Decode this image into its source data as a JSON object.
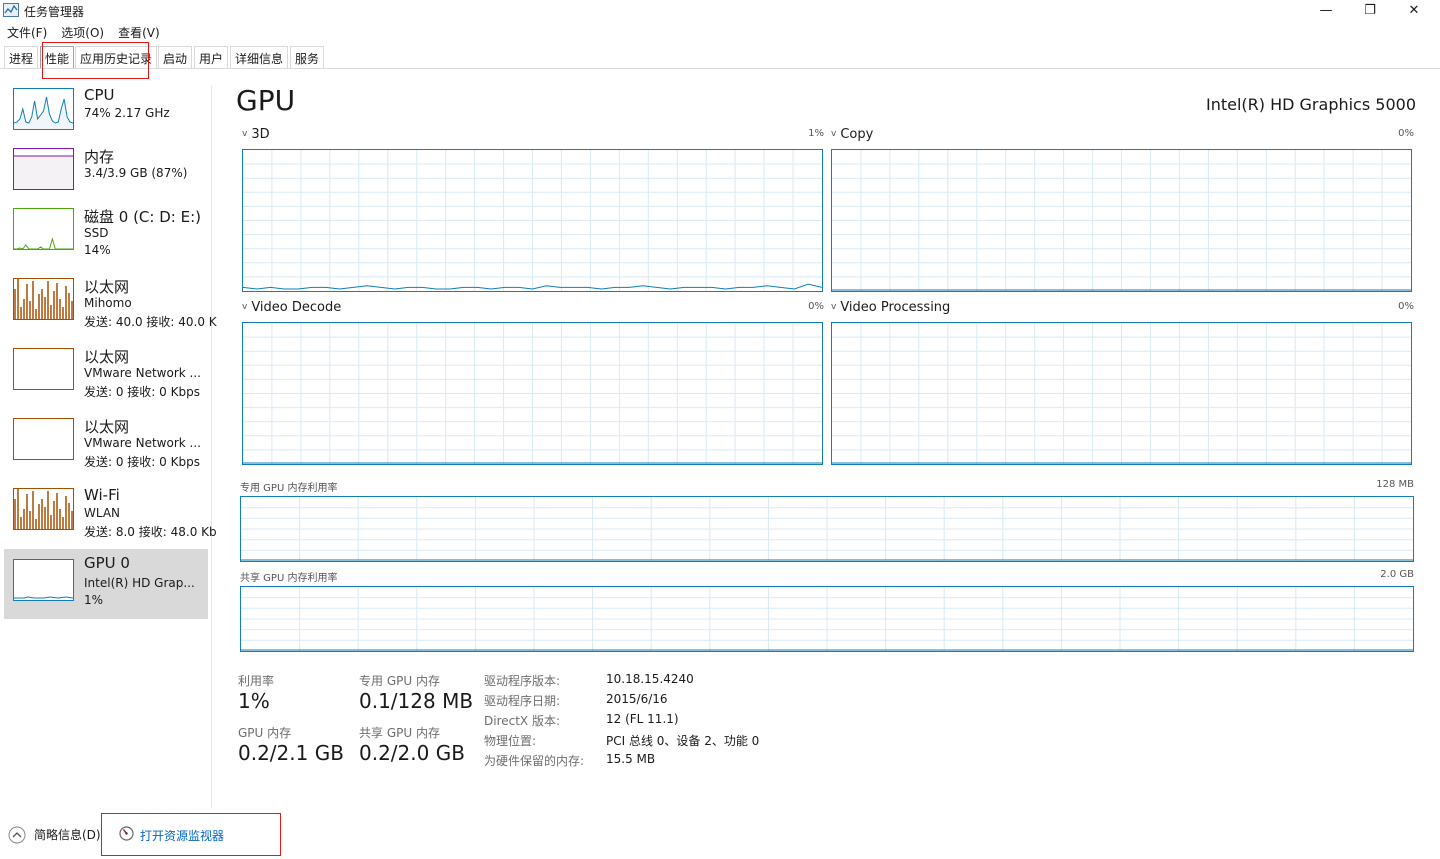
{
  "window": {
    "title": "任务管理器",
    "controls": {
      "minimize": "—",
      "maximize": "❐",
      "close": "✕"
    }
  },
  "menu": [
    "文件(F)",
    "选项(O)",
    "查看(V)"
  ],
  "tabs": [
    "进程",
    "性能",
    "应用历史记录",
    "启动",
    "用户",
    "详细信息",
    "服务"
  ],
  "active_tab": "性能",
  "sidebar": {
    "items": [
      {
        "title": "CPU",
        "line1": "74% 2.17 GHz",
        "line2": "",
        "color": "#117dbb",
        "fill": "#f1f6fa"
      },
      {
        "title": "内存",
        "line1": "3.4/3.9 GB (87%)",
        "line2": "",
        "color": "#8b12ae",
        "fill": "#f4f2f4"
      },
      {
        "title": "磁盘 0 (C: D: E:)",
        "line1": "SSD",
        "line2": "14%",
        "color": "#4da60c",
        "fill": "#eff7e9"
      },
      {
        "title": "以太网",
        "line1": "Mihomo",
        "line2": "发送: 40.0  接收: 40.0 K",
        "color": "#a74f01",
        "fill": "#fcf3eb"
      },
      {
        "title": "以太网",
        "line1": "VMware Network ...",
        "line2": "发送: 0  接收: 0 Kbps",
        "color": "#a74f01",
        "fill": "#fcf3eb"
      },
      {
        "title": "以太网",
        "line1": "VMware Network ...",
        "line2": "发送: 0  接收: 0 Kbps",
        "color": "#a74f01",
        "fill": "#fcf3eb"
      },
      {
        "title": "Wi-Fi",
        "line1": "WLAN",
        "line2": "发送: 8.0  接收: 48.0 Kb",
        "color": "#a74f01",
        "fill": "#fcf3eb"
      },
      {
        "title": "GPU 0",
        "line1": "Intel(R) HD Grap...",
        "line2": "1%",
        "color": "#117dbb",
        "fill": "#f1f6fa"
      }
    ]
  },
  "gpu": {
    "heading": "GPU",
    "model": "Intel(R) HD Graphics 5000",
    "engines": [
      {
        "name": "3D",
        "pct": "1%"
      },
      {
        "name": "Copy",
        "pct": "0%"
      },
      {
        "name": "Video Decode",
        "pct": "0%"
      },
      {
        "name": "Video Processing",
        "pct": "0%"
      }
    ],
    "dedicated_mem_label": "专用 GPU 内存利用率",
    "dedicated_mem_max": "128 MB",
    "shared_mem_label": "共享 GPU 内存利用率",
    "shared_mem_max": "2.0 GB"
  },
  "stats": {
    "utilization_label": "利用率",
    "utilization_value": "1%",
    "dedicated_label": "专用 GPU 内存",
    "dedicated_value": "0.1/128 MB",
    "gpu_mem_label": "GPU 内存",
    "gpu_mem_value": "0.2/2.1 GB",
    "shared_label": "共享 GPU 内存",
    "shared_value": "0.2/2.0 GB"
  },
  "info": [
    {
      "key": "驱动程序版本:",
      "value": "10.18.15.4240"
    },
    {
      "key": "驱动程序日期:",
      "value": "2015/6/16"
    },
    {
      "key": "DirectX 版本:",
      "value": "12 (FL 11.1)"
    },
    {
      "key": "物理位置:",
      "value": "PCI 总线 0、设备 2、功能 0"
    },
    {
      "key": "为硬件保留的内存:",
      "value": "15.5 MB"
    }
  ],
  "footer": {
    "brief": "简略信息(D)",
    "resource_monitor": "打开资源监视器"
  }
}
